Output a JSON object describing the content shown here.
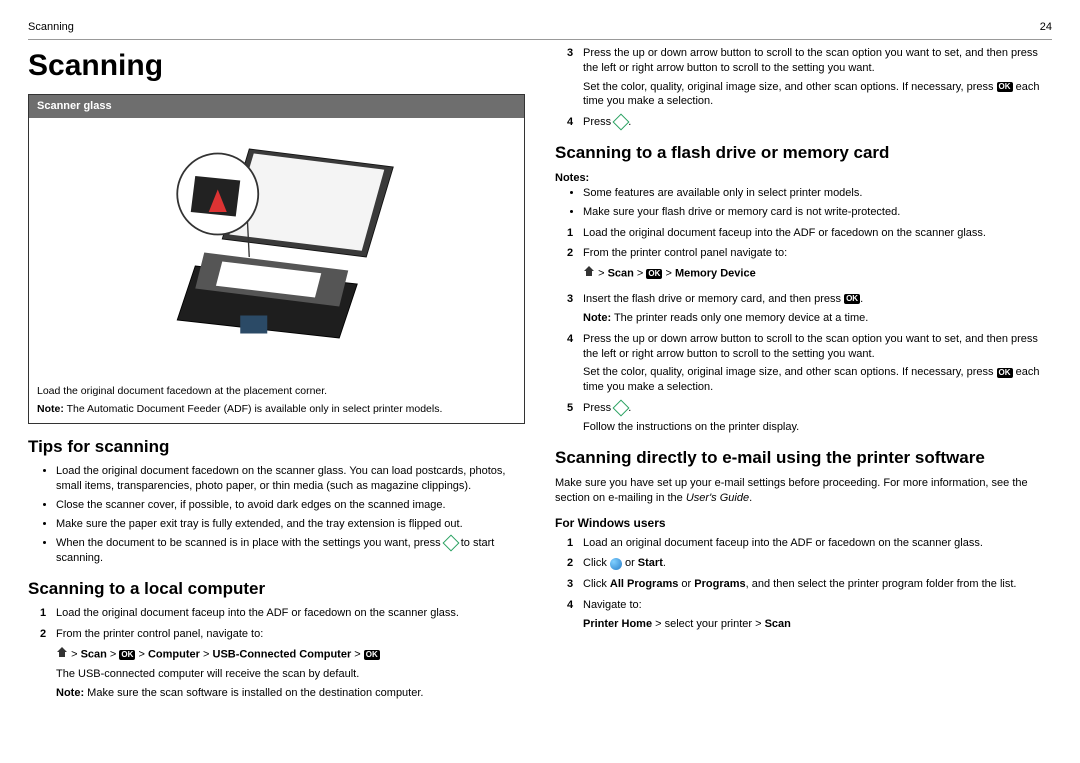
{
  "header": {
    "left": "Scanning",
    "right": "24"
  },
  "title": "Scanning",
  "figure": {
    "title": "Scanner glass",
    "caption": "Load the original document facedown at the placement corner.",
    "note_label": "Note:",
    "note_text": " The Automatic Document Feeder (ADF) is available only in select printer models."
  },
  "tips": {
    "heading": "Tips for scanning",
    "items": [
      "Load the original document facedown on the scanner glass. You can load postcards, photos, small items, transparencies, photo paper, or thin media (such as magazine clippings).",
      "Close the scanner cover, if possible, to avoid dark edges on the scanned image.",
      "Make sure the paper exit tray is fully extended, and the tray extension is flipped out."
    ],
    "item4_pre": "When the document to be scanned is in place with the settings you want, press ",
    "item4_post": " to start scanning."
  },
  "local": {
    "heading": "Scanning to a local computer",
    "step1": "Load the original document faceup into the ADF or facedown on the scanner glass.",
    "step2": "From the printer control panel, navigate to:",
    "nav": {
      "scan": "Scan",
      "computer": "Computer",
      "usb": "USB-Connected Computer"
    },
    "after_nav": "The USB-connected computer will receive the scan by default.",
    "note_label": "Note:",
    "note_text": " Make sure the scan software is installed on the destination computer."
  },
  "right_top": {
    "step3a": "Press the up or down arrow button to scroll to the scan option you want to set, and then press the left or right arrow button to scroll to the setting you want.",
    "step3b_pre": "Set the color, quality, original image size, and other scan options. If necessary, press ",
    "step3b_post": " each time you make a selection.",
    "step4_pre": "Press ",
    "step4_post": "."
  },
  "flash": {
    "heading": "Scanning to a flash drive or memory card",
    "notes_label": "Notes:",
    "notes": [
      "Some features are available only in select printer models.",
      "Make sure your flash drive or memory card is not write-protected."
    ],
    "step1": "Load the original document faceup into the ADF or facedown on the scanner glass.",
    "step2": "From the printer control panel navigate to:",
    "nav": {
      "scan": "Scan",
      "memory": "Memory Device"
    },
    "step3_pre": "Insert the flash drive or memory card, and then press ",
    "step3_post": ".",
    "step3_note_label": "Note:",
    "step3_note_text": " The printer reads only one memory device at a time.",
    "step4a": "Press the up or down arrow button to scroll to the scan option you want to set, and then press the left or right arrow button to scroll to the setting you want.",
    "step4b_pre": "Set the color, quality, original image size, and other scan options. If necessary, press ",
    "step4b_post": " each time you make a selection.",
    "step5_pre": "Press ",
    "step5_post": ".",
    "step5_after": "Follow the instructions on the printer display."
  },
  "email": {
    "heading": "Scanning directly to e‑mail using the printer software",
    "intro_pre": "Make sure you have set up your e-mail settings before proceeding. For more information, see the section on e-mailing in the ",
    "intro_em": "User's Guide",
    "intro_post": ".",
    "windows_heading": "For Windows users",
    "step1": "Load an original document faceup into the ADF or facedown on the scanner glass.",
    "step2_pre": "Click ",
    "step2_or": " or ",
    "step2_start": "Start",
    "step2_post": ".",
    "step3_pre": "Click ",
    "step3_allprograms": "All Programs",
    "step3_or": " or ",
    "step3_programs": "Programs",
    "step3_post": ", and then select the printer program folder from the list.",
    "step4": "Navigate to:",
    "nav": {
      "home": "Printer Home",
      "select": " > select your printer > ",
      "scan": "Scan"
    }
  },
  "ok": "OK",
  "arrow": ">"
}
